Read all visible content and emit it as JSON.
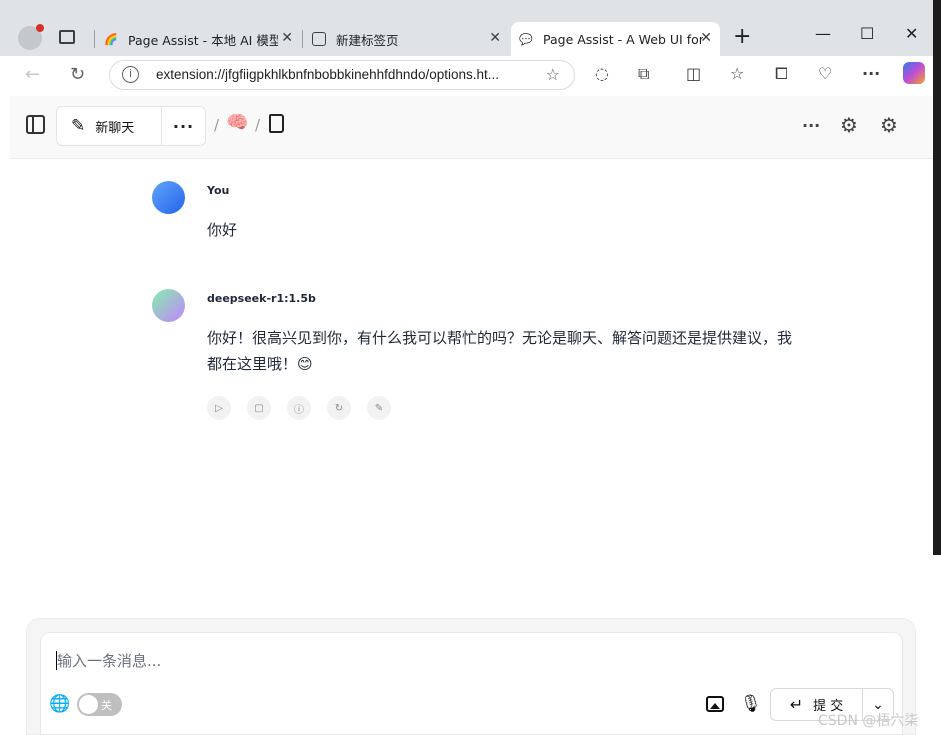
{
  "browser": {
    "tabs": [
      {
        "title": "Page Assist - 本地 AI 模型的",
        "favicon": "rainbow-icon",
        "active": false
      },
      {
        "title": "新建标签页",
        "favicon": "newtab-icon",
        "active": false
      },
      {
        "title": "Page Assist - A Web UI for L",
        "favicon": "chat-bubble-icon",
        "active": true
      }
    ],
    "url": "extension://jfgfiigpkhlkbnfnbobbkinehhfdhndo/options.ht...",
    "window_controls": {
      "minimize": "—",
      "maximize": "☐",
      "close": "✕"
    },
    "new_tab": "+"
  },
  "app": {
    "new_chat_label": "新聊天",
    "more_label": "···"
  },
  "messages": [
    {
      "author": "You",
      "text": "你好"
    },
    {
      "author": "deepseek-r1:1.5b",
      "text": "你好！很高兴见到你，有什么我可以帮忙的吗？无论是聊天、解答问题还是提供建议，我都在这里哦！😊"
    }
  ],
  "composer": {
    "placeholder": "输入一条消息...",
    "web_search_toggle_label": "关",
    "submit_label": "提 交"
  },
  "watermark": "CSDN @梧六柒"
}
